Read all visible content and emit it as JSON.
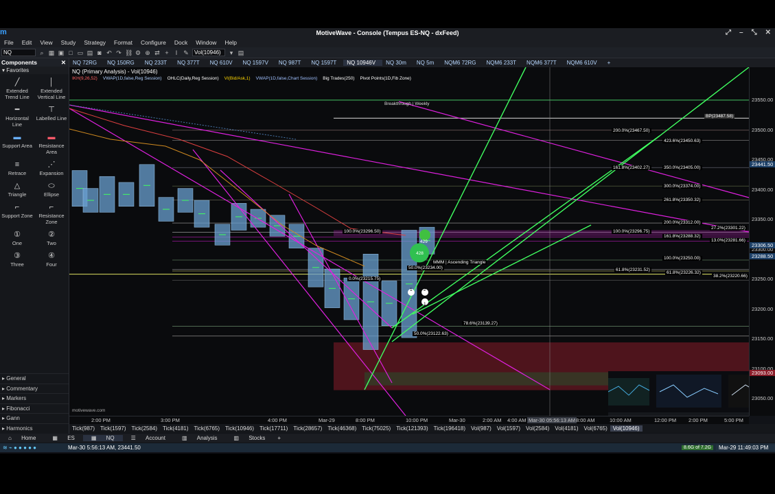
{
  "window": {
    "title": "MotiveWave - Console (Tempus ES-NQ - dxFeed)"
  },
  "menu": [
    "File",
    "Edit",
    "View",
    "Study",
    "Strategy",
    "Format",
    "Configure",
    "Dock",
    "Window",
    "Help"
  ],
  "toolbar": {
    "symbol": "NQ",
    "bar_type": "Vol(10946)"
  },
  "sidebar": {
    "header": "Components",
    "favorites_label": "Favorites",
    "tools": [
      {
        "label": "Extended Trend Line",
        "icon": "extended-trend-line-icon"
      },
      {
        "label": "Extended Vertical Line",
        "icon": "extended-vertical-line-icon"
      },
      {
        "label": "Horizontal Line",
        "icon": "horizontal-line-icon"
      },
      {
        "label": "Labelled Line",
        "icon": "labelled-line-icon"
      },
      {
        "label": "Support Area",
        "icon": "support-area-icon"
      },
      {
        "label": "Resistance Area",
        "icon": "resistance-area-icon"
      },
      {
        "label": "Retrace",
        "icon": "retrace-icon"
      },
      {
        "label": "Expansion",
        "icon": "expansion-icon"
      },
      {
        "label": "Triangle",
        "icon": "triangle-icon"
      },
      {
        "label": "Ellipse",
        "icon": "ellipse-icon"
      },
      {
        "label": "Support Zone",
        "icon": "support-zone-icon"
      },
      {
        "label": "Resistance Zone",
        "icon": "resistance-zone-icon"
      },
      {
        "label": "One",
        "icon": "one-icon"
      },
      {
        "label": "Two",
        "icon": "two-icon"
      },
      {
        "label": "Three",
        "icon": "three-icon"
      },
      {
        "label": "Four",
        "icon": "four-icon"
      }
    ],
    "sections": [
      "General",
      "Commentary",
      "Markers",
      "Fibonacci",
      "Gann",
      "Harmonics"
    ]
  },
  "chart_tabs": [
    "NQ 72RG",
    "NQ 150RG",
    "NQ 233T",
    "NQ 377T",
    "NQ 610V",
    "NQ 1597V",
    "NQ 987T",
    "NQ 1597T",
    "NQ 10946V",
    "NQ 30m",
    "NQ 5m",
    "NQM6 72RG",
    "NQM6 233T",
    "NQM6 377T",
    "NQM6 610V"
  ],
  "chart_tabs_active": "NQ 10946V",
  "chart_title": "NQ (Primary Analysis) - Vol(10946)",
  "studies": [
    "IKH(9,26,52)",
    "VWAP(1D,false,Reg Session)",
    "OHLC(Daily,Reg Session)",
    "VI(Bid/Ask,1)",
    "VWAP(1D,false,Chart Session)",
    "Big Trades(250)",
    "Pivot Points(1D,Fib Zone)"
  ],
  "chart_labels": {
    "breakthrough": "Breakthrough | Weekly",
    "bp": "BP(23487.58)",
    "pattern": "MMM | Ascending Triangle",
    "watermark": "motivewave.com",
    "bubble_1": "429",
    "bubble_2": "428",
    "wave_1": "1",
    "wave_2": "2",
    "wave_3": "1"
  },
  "fib_labels": [
    {
      "text": "200.0%(23467.50)"
    },
    {
      "text": "423.6%(23450.63)"
    },
    {
      "text": "161.8%(23402.27)"
    },
    {
      "text": "350.0%(23405.00)"
    },
    {
      "text": "300.0%(23374.00)"
    },
    {
      "text": "261.8%(23350.32)"
    },
    {
      "text": "200.0%(23312.00)"
    },
    {
      "text": "100.0%(23296.50)"
    },
    {
      "text": "100.0%(23296.75)"
    },
    {
      "text": "27.2%(23301.22)"
    },
    {
      "text": "161.8%(23288.32)"
    },
    {
      "text": "13.0%(23281.66)"
    },
    {
      "text": "100.0%(23250.00)"
    },
    {
      "text": "50.0%(23234.00)"
    },
    {
      "text": "61.8%(23231.52)"
    },
    {
      "text": "61.8%(23226.32)"
    },
    {
      "text": "38.2%(23220.66)"
    },
    {
      "text": "0.0%(23215.75)"
    },
    {
      "text": "78.6%(23139.27)"
    },
    {
      "text": "50.0%(23122.63)"
    }
  ],
  "y_axis": [
    "23550.00",
    "23500.00",
    "23450.00",
    "23400.00",
    "23350.00",
    "23300.00",
    "23250.00",
    "23200.00",
    "23150.00",
    "23100.00",
    "23050.00",
    "23000.00"
  ],
  "y_axis_highlights": [
    "23441.50",
    "23306.50",
    "23288.50",
    "23093.00"
  ],
  "x_axis": [
    "2:00 PM",
    "3:00 PM",
    "4:00 PM",
    "Mar-29",
    "8:00 PM",
    "10:00 PM",
    "Mar-30",
    "2:00 AM",
    "4:00 AM",
    "Mar-30 05:56:13 AM",
    "8:00 AM",
    "10:00 AM",
    "12:00 PM",
    "2:00 PM",
    "5:00 PM"
  ],
  "timeframes": [
    "Tick(987)",
    "Tick(1597)",
    "Tick(2584)",
    "Tick(4181)",
    "Tick(6765)",
    "Tick(10946)",
    "Tick(17711)",
    "Tick(28657)",
    "Tick(46368)",
    "Tick(75025)",
    "Tick(121393)",
    "Tick(196418)",
    "Vol(987)",
    "Vol(1597)",
    "Vol(2584)",
    "Vol(4181)",
    "Vol(6765)",
    "Vol(10946)"
  ],
  "timeframes_active": "Vol(10946)",
  "workspace_tabs": [
    "Home",
    "ES",
    "NQ",
    "Account",
    "Analysis",
    "Stocks"
  ],
  "status": {
    "time_price": "Mar-30 5:56:13 AM, 23441.50",
    "memory": "8.6G of 7.2G",
    "clock": "Mar-29 11:49:03 PM"
  },
  "colors": {
    "magenta": "#e020e0",
    "green": "#40ff60",
    "candle_blue": "#6aa0d0",
    "red_zone": "#6a1a22"
  }
}
